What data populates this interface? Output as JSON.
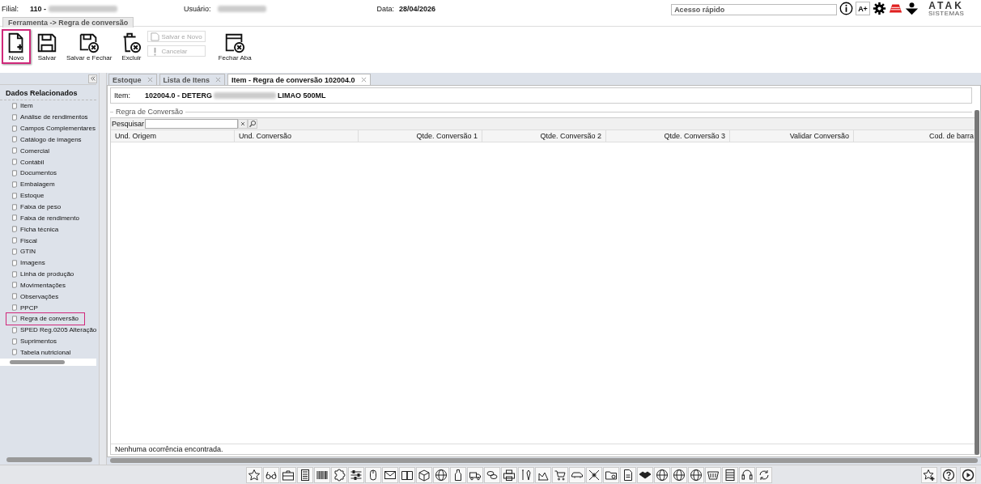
{
  "header": {
    "filial_label": "Filial:",
    "filial_code": "110 -",
    "user_label": "Usuário:",
    "date_label": "Data:",
    "date": "28/04/2026",
    "quick_access": {
      "placeholder": "Acesso rápido"
    },
    "font_button": "A+",
    "logo": {
      "name": "ATAK",
      "tagline": "SISTEMAS"
    }
  },
  "breadcrumb": "Ferramenta -> Regra de conversão",
  "toolbar": [
    {
      "label": "Novo",
      "kind": "new",
      "selected": true,
      "disabled": false
    },
    {
      "label": "Salvar",
      "kind": "save",
      "selected": false,
      "disabled": false
    },
    {
      "label": "Salvar e Fechar",
      "kind": "save-close",
      "selected": false,
      "disabled": false
    },
    {
      "label": "Excluir",
      "kind": "delete",
      "selected": false,
      "disabled": false
    },
    {
      "label": "Salvar e Novo",
      "kind": "small-save",
      "selected": false,
      "disabled": true
    },
    {
      "label": "Cancelar",
      "kind": "small-cancel",
      "selected": false,
      "disabled": true
    },
    {
      "label": "Fechar Aba",
      "kind": "close-tab",
      "selected": false,
      "disabled": false
    }
  ],
  "sidebar": {
    "title": "Dados Relacionados",
    "items": [
      {
        "label": "Item",
        "selected": false
      },
      {
        "label": "Análise de rendimentos",
        "selected": false
      },
      {
        "label": "Campos Complementares",
        "selected": false
      },
      {
        "label": "Catálogo de imagens",
        "selected": false
      },
      {
        "label": "Comercial",
        "selected": false
      },
      {
        "label": "Contábil",
        "selected": false
      },
      {
        "label": "Documentos",
        "selected": false
      },
      {
        "label": "Embalagem",
        "selected": false
      },
      {
        "label": "Estoque",
        "selected": false
      },
      {
        "label": "Faixa de peso",
        "selected": false
      },
      {
        "label": "Faixa de rendimento",
        "selected": false
      },
      {
        "label": "Ficha técnica",
        "selected": false
      },
      {
        "label": "Fiscal",
        "selected": false
      },
      {
        "label": "GTIN",
        "selected": false
      },
      {
        "label": "Imagens",
        "selected": false
      },
      {
        "label": "Linha de produção",
        "selected": false
      },
      {
        "label": "Movimentações",
        "selected": false
      },
      {
        "label": "Observações",
        "selected": false
      },
      {
        "label": "PPCP",
        "selected": false
      },
      {
        "label": "Regra de conversão",
        "selected": true
      },
      {
        "label": "SPED Reg.0205 Alteração",
        "selected": false
      },
      {
        "label": "Suprimentos",
        "selected": false
      },
      {
        "label": "Tabela nutricional",
        "selected": false
      }
    ]
  },
  "tabs": [
    {
      "label": "Estoque",
      "selected": false
    },
    {
      "label": "Lista de Itens",
      "selected": false
    },
    {
      "label": "Item - Regra de conversão 102004.0",
      "selected": true
    }
  ],
  "item": {
    "label": "Item:",
    "code": "102004.0 - DETERG",
    "name_end": "LIMAO 500ML"
  },
  "section": {
    "title": "Regra de Conversão",
    "search_label": "Pesquisar",
    "columns": [
      {
        "label": "Und. Origem",
        "kind": "text"
      },
      {
        "label": "Und. Conversão",
        "kind": "text"
      },
      {
        "label": "Qtde. Conversão 1",
        "kind": "number"
      },
      {
        "label": "Qtde. Conversão 2",
        "kind": "number"
      },
      {
        "label": "Qtde. Conversão 3",
        "kind": "number"
      },
      {
        "label": "Validar Conversão",
        "kind": "number"
      },
      {
        "label": "Cod. de barra",
        "kind": "number"
      }
    ],
    "status": "Nenhuma ocorrência encontrada."
  }
}
